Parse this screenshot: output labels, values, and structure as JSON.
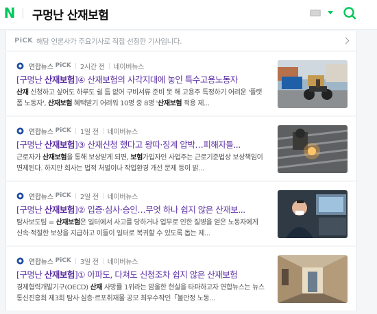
{
  "header": {
    "logo": "N",
    "title": "구멍난 산재보험"
  },
  "pick_notice": {
    "badge": "PiCK",
    "text": "해당 언론사가 주요기사로 직접 선정한 기사입니다."
  },
  "articles": [
    {
      "press": "연합뉴스",
      "pick": "PiCK",
      "time": "2시간 전",
      "source": "네이버뉴스",
      "title_pre": "[구멍난 ",
      "title_bold": "산재보험",
      "title_post": "]④ 산재보험의 사각지대에 놓인 특수고용노동자",
      "snippet_html": "<b>산재</b> 신청하고 싶어도 하루도 쉴 틈 없어 구비서류 준비 못 해 고용주 특정하기 어려운 '플랫폼 노동자', <b>산재보험</b> 혜택받기 어려워 10명 중 8명 '<b>산재보험</b> 적용 제...",
      "thumb": "motorbike"
    },
    {
      "press": "연합뉴스",
      "pick": "PiCK",
      "time": "1일 전",
      "source": "네이버뉴스",
      "title_pre": "[구멍난 ",
      "title_bold": "산재보험",
      "title_post": "]③ 산재신청 했다고 왕따·징계 압박…피해자들...",
      "snippet_html": "근로자가 <b>산재보험</b>을 통해 보상받게 되면, <b>보험</b>가입자인 사업주는 근로기준법상 보상책임이 면제된다. 하지만 회사는 법적 처벌이나 작업환경 개선 문제 등이 밝...",
      "thumb": "welding"
    },
    {
      "press": "연합뉴스",
      "pick": "PiCK",
      "time": "2일 전",
      "source": "네이버뉴스",
      "title_pre": "[구멍난 ",
      "title_bold": "산재보험",
      "title_post": "]② 입증·심사·승인…무엇 하나 쉽지 않은 산재보...",
      "snippet_html": "탐사보도팀 = <b>산재보험</b>은 일터에서 사고를 당하거나 업무로 인한 질병을 얻은 노동자에게 신속·적절한 보상을 지급하고 이들이 일터로 복귀할 수 있도록 돕는 제...",
      "thumb": "office"
    },
    {
      "press": "연합뉴스",
      "pick": "PiCK",
      "time": "3일 전",
      "source": "네이버뉴스",
      "title_pre": "[구멍난 ",
      "title_bold": "산재보험",
      "title_post": "]① 아파도, 다쳐도 신청조차 쉽지 않은 산재보험",
      "snippet_html": "경제협력개발기구(OECD) <b>산재</b> 사망률 1위라는 암울한 현실을 타파하고자 연합뉴스는 뉴스통신진흥회 제3회 탐사·심층·르포취재물 공모 최우수작인「불안정 노동...",
      "thumb": "hallway"
    }
  ],
  "colors": {
    "brand": "#03c75a",
    "visited_link": "#5b2fa3"
  }
}
